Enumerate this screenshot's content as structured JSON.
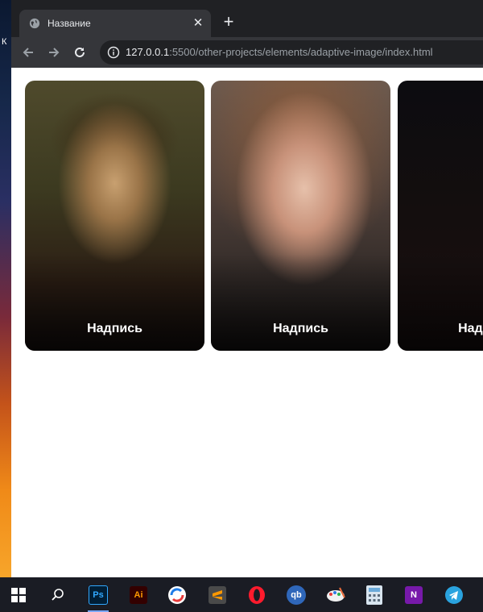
{
  "wallpaper": {
    "edge_letter": "К"
  },
  "browser": {
    "tab": {
      "title": "Название",
      "favicon": "globe-icon",
      "close_icon": "close-icon"
    },
    "new_tab": "+",
    "address": {
      "host": "127.0.0.1",
      "path": ":5500/other-projects/elements/adaptive-image/index.html"
    }
  },
  "cards": [
    {
      "caption": "Надпись"
    },
    {
      "caption": "Надпись"
    },
    {
      "caption": "Надпись"
    }
  ],
  "taskbar": {
    "items": [
      {
        "name": "windows-start-icon"
      },
      {
        "name": "search-icon"
      },
      {
        "name": "photoshop-icon",
        "label": "Ps",
        "color": "#31a8ff",
        "bg": "#001e36"
      },
      {
        "name": "illustrator-icon",
        "label": "Ai",
        "color": "#ff9a00",
        "bg": "#330000"
      },
      {
        "name": "sync-app-icon"
      },
      {
        "name": "sublime-text-icon"
      },
      {
        "name": "opera-icon"
      },
      {
        "name": "qbittorrent-icon",
        "label": "qb"
      },
      {
        "name": "paint-icon"
      },
      {
        "name": "calculator-icon"
      },
      {
        "name": "onenote-icon",
        "label": "N"
      },
      {
        "name": "telegram-icon"
      }
    ]
  }
}
